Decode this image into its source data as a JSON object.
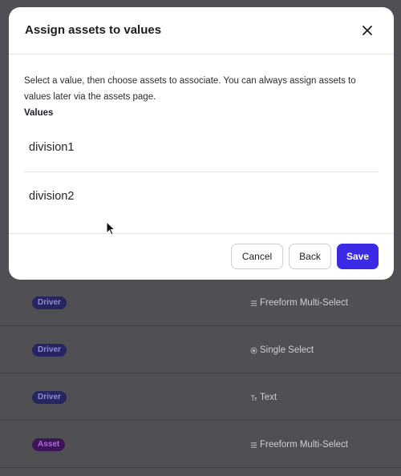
{
  "modal": {
    "title": "Assign assets to values",
    "description": "Select a value, then choose assets to associate. You can always assign assets to values later via the assets page.",
    "values_label": "Values",
    "values": [
      "division1",
      "division2"
    ],
    "buttons": {
      "cancel": "Cancel",
      "back": "Back",
      "save": "Save"
    }
  },
  "background_rows": [
    {
      "badge": "Driver",
      "badge_kind": "driver",
      "type": "Freeform Multi-Select",
      "type_icon": "list-icon"
    },
    {
      "badge": "Driver",
      "badge_kind": "driver",
      "type": "Single Select",
      "type_icon": "radio-icon"
    },
    {
      "badge": "Driver",
      "badge_kind": "driver",
      "type": "Text",
      "type_icon": "text-icon"
    },
    {
      "badge": "Asset",
      "badge_kind": "asset",
      "type": "Freeform Multi-Select",
      "type_icon": "list-icon"
    }
  ],
  "colors": {
    "primary": "#3b2be4",
    "overlay": "#505054",
    "badge_driver": "#262461",
    "badge_asset": "#3b1757"
  }
}
